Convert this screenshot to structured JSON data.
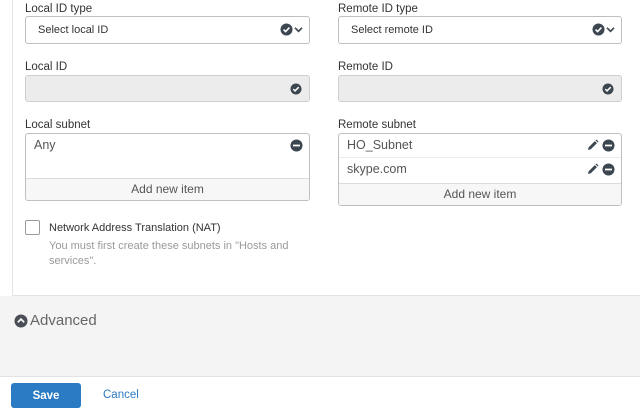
{
  "local_id_type": {
    "label": "Local ID type",
    "value": "Select local ID"
  },
  "remote_id_type": {
    "label": "Remote ID type",
    "value": "Select remote ID"
  },
  "local_id": {
    "label": "Local ID",
    "value": ""
  },
  "remote_id": {
    "label": "Remote ID",
    "value": ""
  },
  "local_subnet": {
    "label": "Local subnet",
    "items": [
      "Any"
    ],
    "add_label": "Add new item"
  },
  "remote_subnet": {
    "label": "Remote subnet",
    "items": [
      "HO_Subnet",
      "skype.com"
    ],
    "add_label": "Add new item"
  },
  "nat": {
    "checked": false,
    "label": "Network Address Translation (NAT)",
    "help": "You must first create these subnets in \"Hosts and services\"."
  },
  "advanced": {
    "label": "Advanced",
    "icon": "chevron-up-circle-icon"
  },
  "footer": {
    "save_label": "Save",
    "cancel_label": "Cancel"
  },
  "colors": {
    "accent": "#2b7bc4",
    "icon_dark": "#3c4650",
    "readonly_bg": "#ececec"
  }
}
